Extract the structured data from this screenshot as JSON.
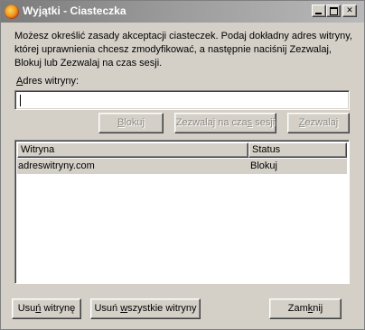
{
  "window": {
    "title": "Wyjątki - Ciasteczka",
    "controls": {
      "minimize_icon": "minimize-icon",
      "maximize_icon": "maximize-icon",
      "close_glyph": "✕"
    }
  },
  "description": "Możesz określić zasady akceptacji ciasteczek. Podaj dokładny adres witryny, której uprawnienia chcesz zmodyfikować, a następnie naciśnij Zezwalaj, Blokuj lub Zezwalaj na czas sesji.",
  "address": {
    "label_accel": "A",
    "label_rest": "dres witryny:",
    "value": ""
  },
  "actions": {
    "block": {
      "accel": "B",
      "rest": "lokuj"
    },
    "session": {
      "before": "Zezwalaj na cza",
      "accel": "s",
      "after": " sesji"
    },
    "allow": {
      "accel": "Z",
      "rest": "ezwalaj"
    }
  },
  "table": {
    "columns": [
      "Witryna",
      "Status"
    ],
    "rows": [
      {
        "site": "adreswitryny.com",
        "status": "Blokuj"
      }
    ]
  },
  "footer": {
    "remove": {
      "before": "Usu",
      "accel": "ń",
      "after": " witrynę"
    },
    "remove_all": {
      "before": "Usuń ",
      "accel": "w",
      "after": "szystkie witryny"
    },
    "close": {
      "before": "Zam",
      "accel": "k",
      "after": "nij"
    }
  }
}
